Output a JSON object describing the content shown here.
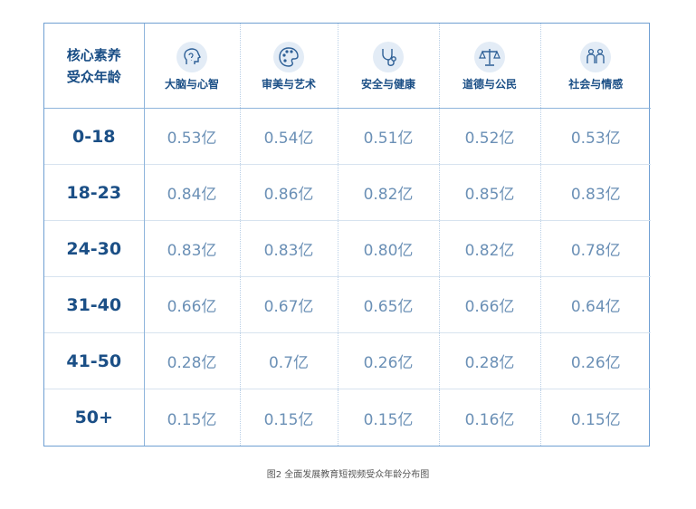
{
  "chart_data": {
    "type": "table",
    "corner_label": [
      "核心素养",
      "受众年龄"
    ],
    "columns": [
      {
        "label": "大脑与心智",
        "icon": "brain-head-icon"
      },
      {
        "label": "审美与艺术",
        "icon": "palette-icon"
      },
      {
        "label": "安全与健康",
        "icon": "stethoscope-icon"
      },
      {
        "label": "道德与公民",
        "icon": "scales-icon"
      },
      {
        "label": "社会与情感",
        "icon": "people-icon"
      }
    ],
    "rows": [
      {
        "age": "0-18",
        "values": [
          "0.53亿",
          "0.54亿",
          "0.51亿",
          "0.52亿",
          "0.53亿"
        ]
      },
      {
        "age": "18-23",
        "values": [
          "0.84亿",
          "0.86亿",
          "0.82亿",
          "0.85亿",
          "0.83亿"
        ]
      },
      {
        "age": "24-30",
        "values": [
          "0.83亿",
          "0.83亿",
          "0.80亿",
          "0.82亿",
          "0.78亿"
        ]
      },
      {
        "age": "31-40",
        "values": [
          "0.66亿",
          "0.67亿",
          "0.65亿",
          "0.66亿",
          "0.64亿"
        ]
      },
      {
        "age": "41-50",
        "values": [
          "0.28亿",
          "0.7亿",
          "0.26亿",
          "0.28亿",
          "0.26亿"
        ]
      },
      {
        "age": "50+",
        "values": [
          "0.15亿",
          "0.15亿",
          "0.15亿",
          "0.16亿",
          "0.15亿"
        ]
      }
    ],
    "caption": "图2 全面发展教育短视频受众年龄分布图",
    "colors": {
      "border": "#6f9fd2",
      "heading": "#1b4f86",
      "value": "#6b90b6",
      "icon_bg": "#e3ecf6"
    }
  }
}
